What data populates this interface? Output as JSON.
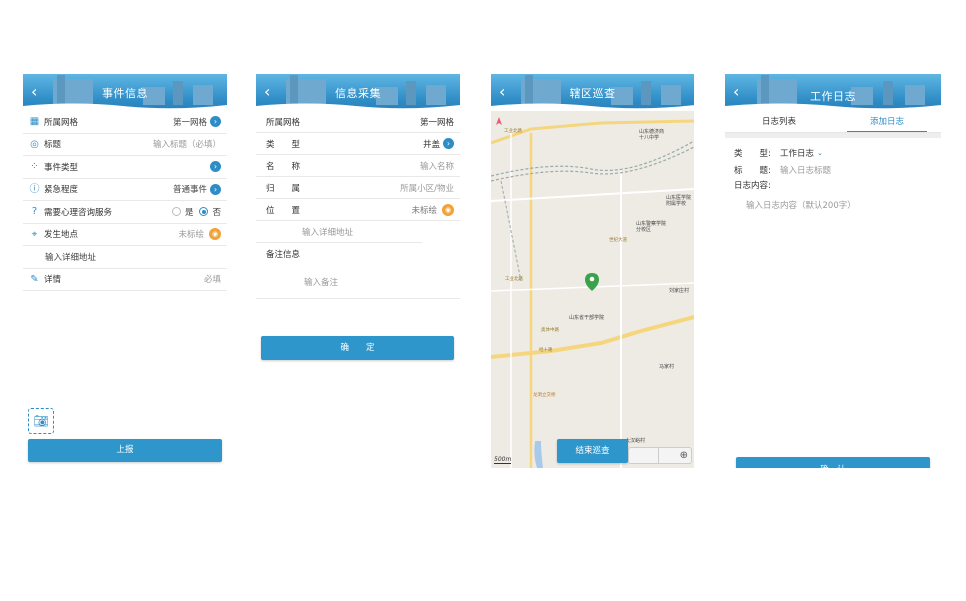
{
  "screens": {
    "event": {
      "title": "事件信息",
      "rows": [
        {
          "label": "所属网格",
          "value": "第一网格"
        },
        {
          "label": "标题",
          "value": "输入标题（必填）"
        },
        {
          "label": "事件类型",
          "value": ""
        },
        {
          "label": "紧急程度",
          "value": "普通事件"
        },
        {
          "label": "需要心理咨询服务",
          "opt_yes": "是",
          "opt_no": "否"
        },
        {
          "label": "发生地点",
          "value": "未标绘"
        },
        {
          "label": "输入详细地址"
        },
        {
          "label": "详情",
          "value": "必填"
        }
      ],
      "submit": "上报"
    },
    "collect": {
      "title": "信息采集",
      "rows": [
        {
          "label": "所属网格",
          "value": "第一网格"
        },
        {
          "label": "类　　型",
          "value": "井盖"
        },
        {
          "label": "名　　称",
          "value": "输入名称"
        },
        {
          "label": "归　　属",
          "value": "所属小区/物业"
        },
        {
          "label": "位　　置",
          "value": "未标绘"
        }
      ],
      "address_placeholder": "输入详细地址",
      "remark_label": "备注信息",
      "remark_placeholder": "输入备注",
      "confirm": "确　　定"
    },
    "patrol": {
      "title": "辖区巡查",
      "scale": "500m",
      "end_button": "结束巡查",
      "map_labels": [
        "山东德济商\n十八中学",
        "山东医学院\n附属学校",
        "山东警察学院\n分校区",
        "世纪大道",
        "刘家庄村",
        "山东省干部学院",
        "工业北路",
        "马家村",
        "大汉峪村",
        "龙洞立交桥",
        "经十路",
        "工业北路",
        "奥体中路"
      ]
    },
    "log": {
      "title": "工作日志",
      "tabs": [
        "日志列表",
        "添加日志"
      ],
      "type_label": "类　　型:",
      "type_value": "工作日志",
      "title_label": "标　　题:",
      "title_placeholder": "输入日志标题",
      "content_label": "日志内容:",
      "content_placeholder": "输入日志内容（默认200字）",
      "confirm": "确　认"
    }
  },
  "colors": {
    "primary": "#2f8dc6",
    "button": "#2f96cb",
    "marker": "#f2a237",
    "pin": "#3aa24a"
  }
}
